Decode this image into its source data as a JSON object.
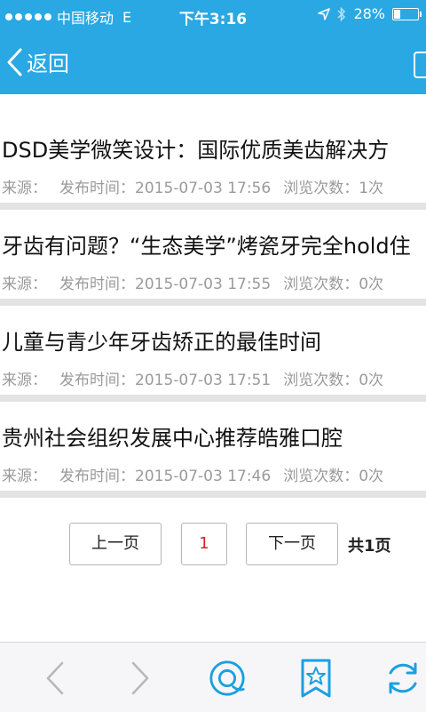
{
  "status_bar": {
    "carrier": "中国移动",
    "network": "E",
    "time": "下午3:16",
    "battery": "28%",
    "battery_level": 0.28
  },
  "nav": {
    "back_label": "返回"
  },
  "articles": [
    {
      "title": "DSD美学微笑设计：国际优质美齿解决方",
      "source_label": "来源：",
      "time_label": "发布时间：2015-07-03 17:56",
      "views_label": "浏览次数：1次"
    },
    {
      "title": "牙齿有问题？“生态美学”烤瓷牙完全hold住",
      "source_label": "来源：",
      "time_label": "发布时间：2015-07-03 17:55",
      "views_label": "浏览次数：0次"
    },
    {
      "title": "儿童与青少年牙齿矫正的最佳时间",
      "source_label": "来源：",
      "time_label": "发布时间：2015-07-03 17:51",
      "views_label": "浏览次数：0次"
    },
    {
      "title": "贵州社会组织发展中心推荐皓雅口腔",
      "source_label": "来源：",
      "time_label": "发布时间：2015-07-03 17:46",
      "views_label": "浏览次数：0次"
    }
  ],
  "pagination": {
    "prev_label": "上一页",
    "current_page": "1",
    "next_label": "下一页",
    "total_label": "共1页"
  },
  "toolbar": {
    "icons": [
      "back-arrow-icon",
      "forward-arrow-icon",
      "browser-icon",
      "bookmark-star-icon",
      "refresh-icon"
    ]
  },
  "colors": {
    "accent": "#29a8e4",
    "current_page": "#d3242a",
    "meta_text": "#9a9a9a"
  }
}
